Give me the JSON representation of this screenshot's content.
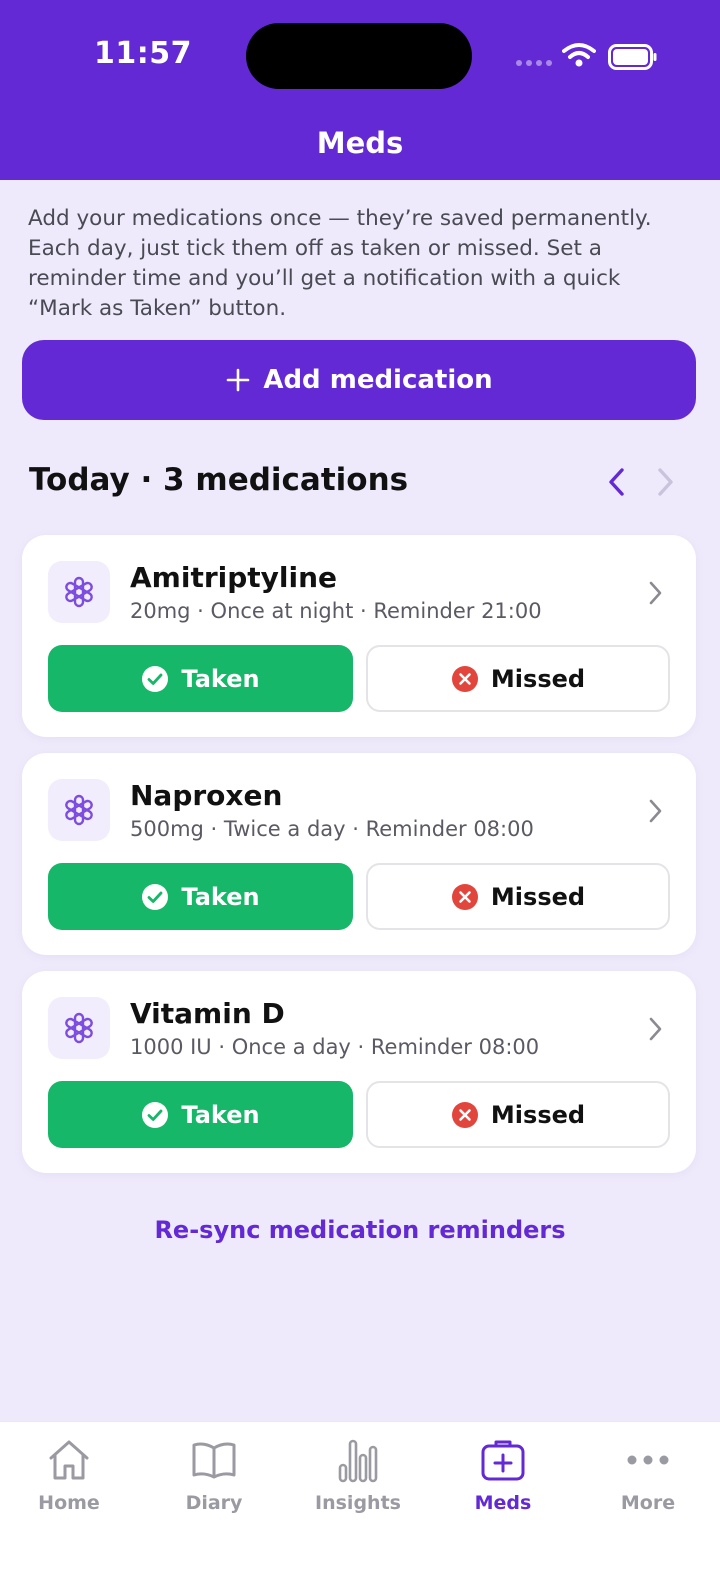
{
  "status_bar": {
    "time": "11:57"
  },
  "header": {
    "title": "Meds"
  },
  "intro_text": "Add your medications once — they’re saved permanently. Each day, just tick them off as taken or missed. Set a reminder time and you’ll get a notification with a quick “Mark as Taken” button.",
  "add_button": {
    "icon": "plus-icon",
    "label": "Add medication"
  },
  "section": {
    "title": "Today · 3 medications"
  },
  "medications": [
    {
      "name": "Amitriptyline",
      "detail": "20mg · Once at night · Reminder 21:00",
      "taken_label": "Taken",
      "missed_label": "Missed"
    },
    {
      "name": "Naproxen",
      "detail": "500mg · Twice a day · Reminder 08:00",
      "taken_label": "Taken",
      "missed_label": "Missed"
    },
    {
      "name": "Vitamin D",
      "detail": "1000 IU · Once a day · Reminder 08:00",
      "taken_label": "Taken",
      "missed_label": "Missed"
    }
  ],
  "resync_link": "Re-sync medication reminders",
  "tabs": [
    {
      "label": "Home",
      "icon": "home-icon",
      "active": false
    },
    {
      "label": "Diary",
      "icon": "book-icon",
      "active": false
    },
    {
      "label": "Insights",
      "icon": "bar-chart-icon",
      "active": false
    },
    {
      "label": "Meds",
      "icon": "medical-kit-icon",
      "active": true
    },
    {
      "label": "More",
      "icon": "more-dots-icon",
      "active": false
    }
  ],
  "colors": {
    "brand": "#6229d4",
    "taken": "#17b76a",
    "missed": "#e2453c",
    "background": "#efeafb"
  }
}
